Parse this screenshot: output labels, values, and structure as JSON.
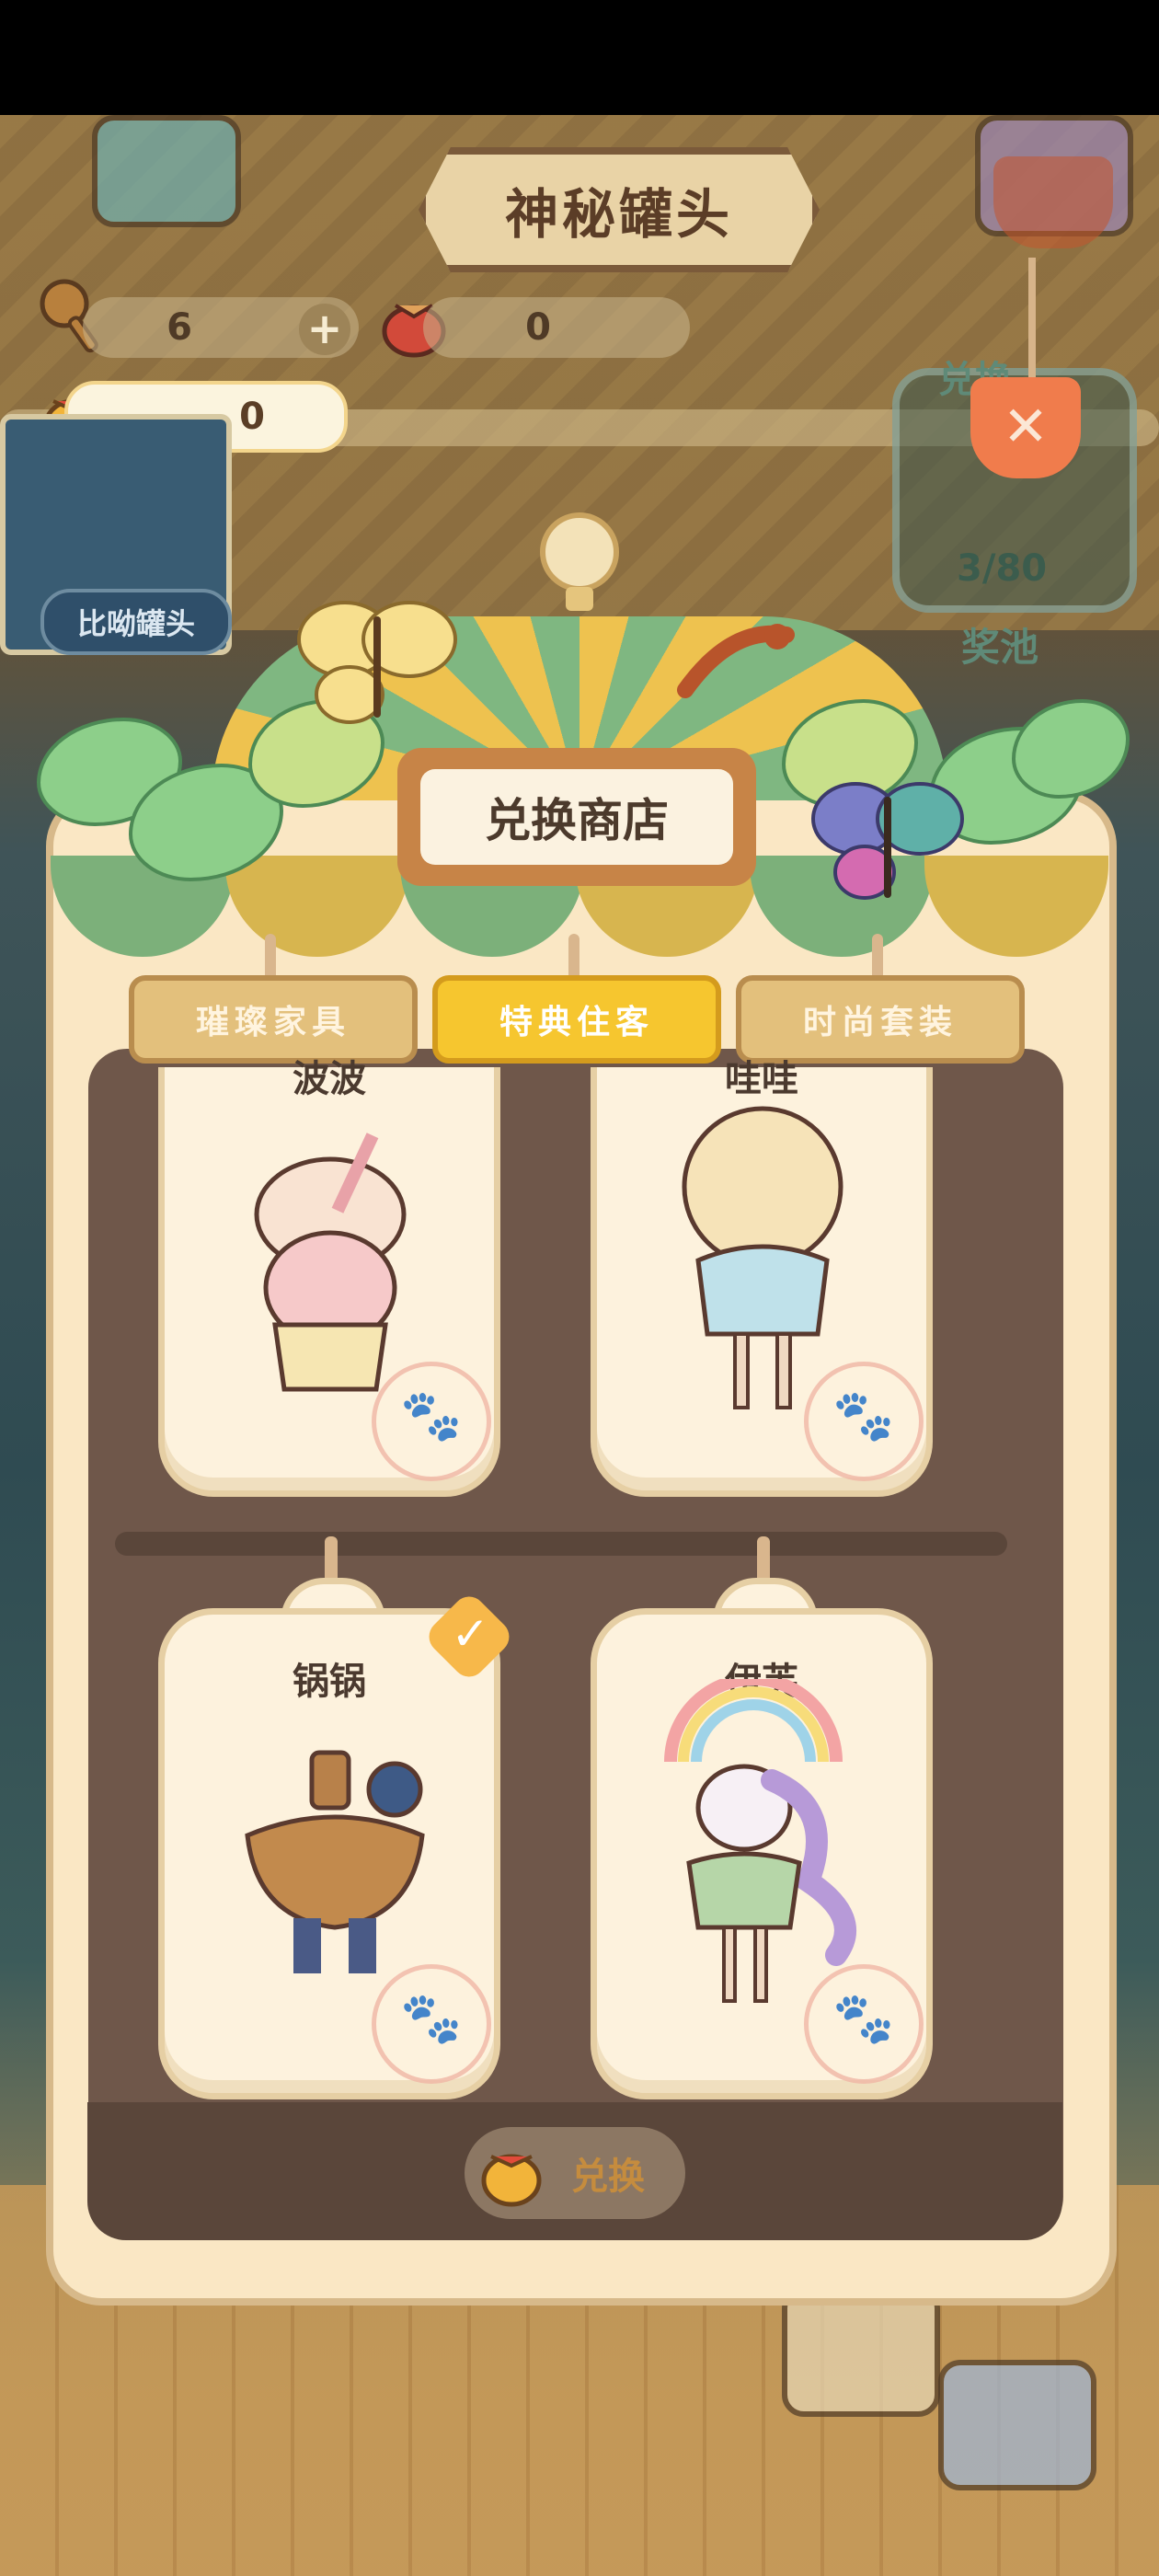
{
  "header": {
    "title": "神秘罐头"
  },
  "currencies": {
    "keys_count": "6",
    "bell_red_count": "0",
    "bell_gold_count": "0"
  },
  "side": {
    "button_label": "比呦罐头"
  },
  "right_badge": {
    "label": "兑换",
    "progress": "3/80",
    "pool_label": "奖池"
  },
  "shop": {
    "sign": "兑换商店",
    "tabs": [
      {
        "label": "璀璨家具"
      },
      {
        "label": "特典住客"
      },
      {
        "label": "时尚套装"
      }
    ],
    "active_tab": 1,
    "cards": [
      {
        "name": "波波",
        "selected": false
      },
      {
        "name": "哇哇",
        "selected": false
      },
      {
        "name": "锅锅",
        "selected": true
      },
      {
        "name": "伊芙",
        "selected": false
      }
    ],
    "exchange_label": "兑换"
  },
  "colors": {
    "panel": "#fae7c4",
    "panel_inner": "#6f574a",
    "active_tab": "#f6c62f",
    "accent_orange": "#f07c4c"
  }
}
